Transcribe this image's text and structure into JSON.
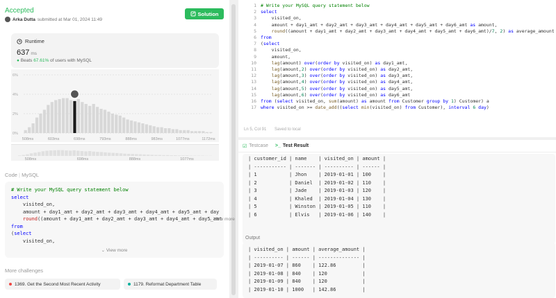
{
  "submission": {
    "status": "Accepted",
    "author": "Arka Dutta",
    "submitted_text": "submitted at Mar 01, 2024 11:49",
    "solution_label": "Solution"
  },
  "runtime": {
    "label": "Runtime",
    "value": "637",
    "unit": "ms",
    "beats_prefix": "Beats",
    "beats_pct": "67.61%",
    "beats_suffix": "of users with MySQL"
  },
  "chart_data": {
    "type": "bar",
    "y_ticks": [
      "6%",
      "4%",
      "2%",
      "0%"
    ],
    "x_ticks": [
      "508ms",
      "603ms",
      "698ms",
      "793ms",
      "888ms",
      "983ms",
      "1077ms",
      "1172ms"
    ],
    "mini_ticks": [
      "508ms",
      "698ms",
      "888ms",
      "1077ms"
    ],
    "ylim": [
      0,
      6
    ],
    "highlight_index": 13,
    "values": [
      0.3,
      0.6,
      1.0,
      1.6,
      2.0,
      2.4,
      2.9,
      3.2,
      3.4,
      3.5,
      3.6,
      3.6,
      3.4,
      3.3,
      3.5,
      3.2,
      3.0,
      2.8,
      3.0,
      2.7,
      2.5,
      2.4,
      2.2,
      2.0,
      1.9,
      1.8,
      1.6,
      1.4,
      1.3,
      1.2,
      1.1,
      1.0,
      0.9,
      0.8,
      0.7,
      0.6,
      0.6,
      0.5,
      0.5,
      0.4,
      0.4,
      0.3,
      0.3,
      0.3,
      0.2,
      0.2,
      0.2,
      0.2,
      0.1,
      0.1
    ]
  },
  "code_section": {
    "label": "Code",
    "lang": "MySQL",
    "view_more": "View more",
    "lines": [
      "# Write your MySQL query statement below",
      "select",
      "    visited_on,",
      "    amount + day1_amt + day2_amt + day3_amt + day4_amt + day5_amt + day",
      "    round((amount + day1_amt + day2_amt + day3_amt + day4_amt + day5_amt",
      "from",
      "(select",
      "    visited_on,"
    ]
  },
  "more_challenges": {
    "label": "More challenges",
    "items": [
      {
        "text": "1369. Get the Second Most Recent Activity",
        "color": "#ef4743"
      },
      {
        "text": "1179. Reformat Department Table",
        "color": "#00af9b"
      }
    ]
  },
  "editor": {
    "line_numbers": [
      "1",
      "2",
      "3",
      "4",
      "5",
      "6",
      "7",
      "8",
      "9",
      "10",
      "11",
      "12",
      "13",
      "14",
      "15",
      "16",
      "17"
    ],
    "status_pos": "Ln 5, Col 91",
    "status_saved": "Saved to local"
  },
  "bottom": {
    "tab_testcase": "Testcase",
    "tab_result": "Test Result",
    "input_table": "| customer_id | name    | visited_on | amount |\n| ----------- | ------- | ---------- | ------ |\n| 1           | Jhon    | 2019-01-01 | 100    |\n| 2           | Daniel  | 2019-01-02 | 110    |\n| 3           | Jade    | 2019-01-03 | 120    |\n| 4           | Khaled  | 2019-01-04 | 130    |\n| 5           | Winston | 2019-01-05 | 110    |\n| 6           | Elvis   | 2019-01-06 | 140    |",
    "view_more": "View more",
    "output_label": "Output",
    "output_table": "| visited_on | amount | average_amount |\n| ---------- | ------ | -------------- |\n| 2019-01-07 | 860    | 122.86         |\n| 2019-01-08 | 840    | 120            |\n| 2019-01-09 | 840    | 120            |\n| 2019-01-10 | 1000   | 142.86         |"
  }
}
